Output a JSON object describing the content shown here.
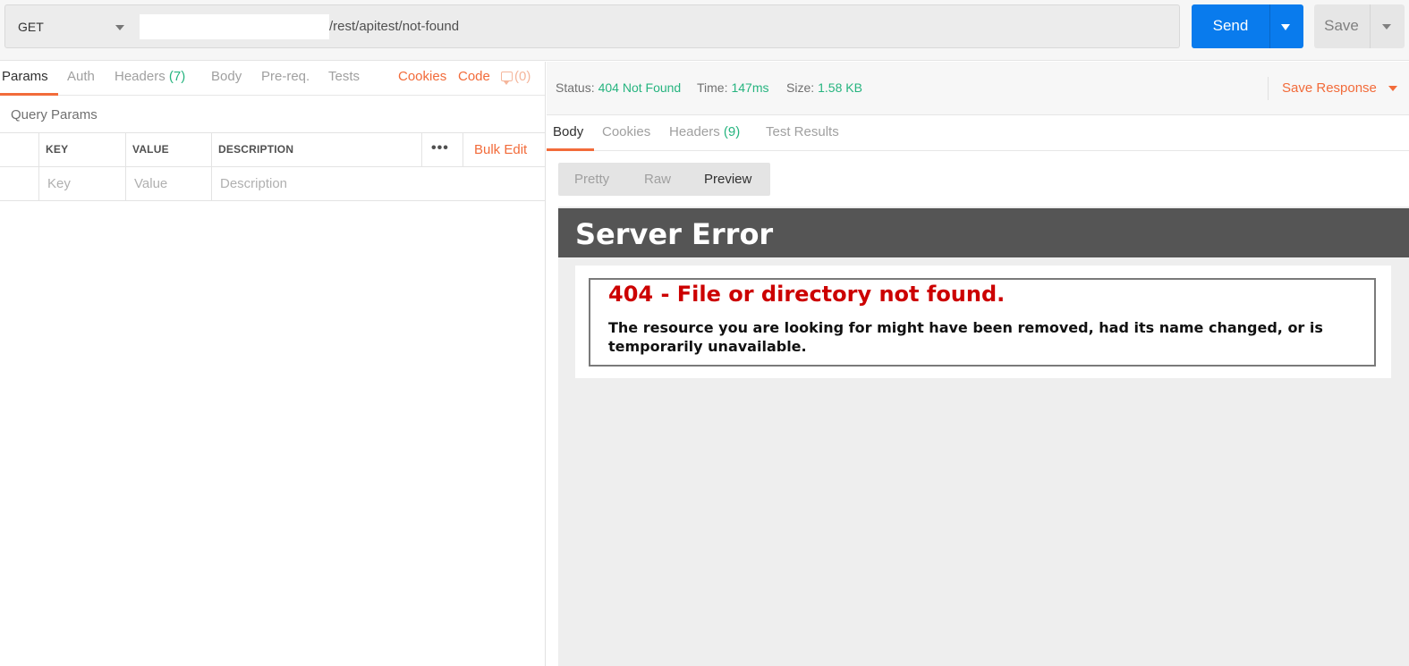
{
  "request": {
    "method": "GET",
    "url_path": "/rest/apitest/not-found",
    "send_label": "Send",
    "save_label": "Save"
  },
  "request_tabs": {
    "params": "Params",
    "auth": "Auth",
    "headers": "Headers",
    "headers_count": "(7)",
    "body": "Body",
    "prereq": "Pre-req.",
    "tests": "Tests",
    "cookies": "Cookies",
    "code": "Code",
    "comments_count": "(0)"
  },
  "query_params": {
    "title": "Query Params",
    "columns": [
      "KEY",
      "VALUE",
      "DESCRIPTION"
    ],
    "more": "•••",
    "bulk_edit": "Bulk Edit",
    "placeholders": {
      "key": "Key",
      "value": "Value",
      "description": "Description"
    }
  },
  "response": {
    "status_label": "Status:",
    "status_value": "404 Not Found",
    "time_label": "Time:",
    "time_value": "147ms",
    "size_label": "Size:",
    "size_value": "1.58 KB",
    "save_response": "Save Response",
    "tabs": {
      "body": "Body",
      "cookies": "Cookies",
      "headers": "Headers",
      "headers_count": "(9)",
      "test_results": "Test Results"
    },
    "views": [
      "Pretty",
      "Raw",
      "Preview"
    ],
    "active_view": "Preview"
  },
  "preview": {
    "header": "Server Error",
    "error_title": "404 - File or directory not found.",
    "error_message": "The resource you are looking for might have been removed, had its name changed, or is temporarily unavailable."
  },
  "colors": {
    "accent": "#f26b3a",
    "send": "#097bed",
    "success": "#26b47f",
    "error": "#cc0000"
  }
}
